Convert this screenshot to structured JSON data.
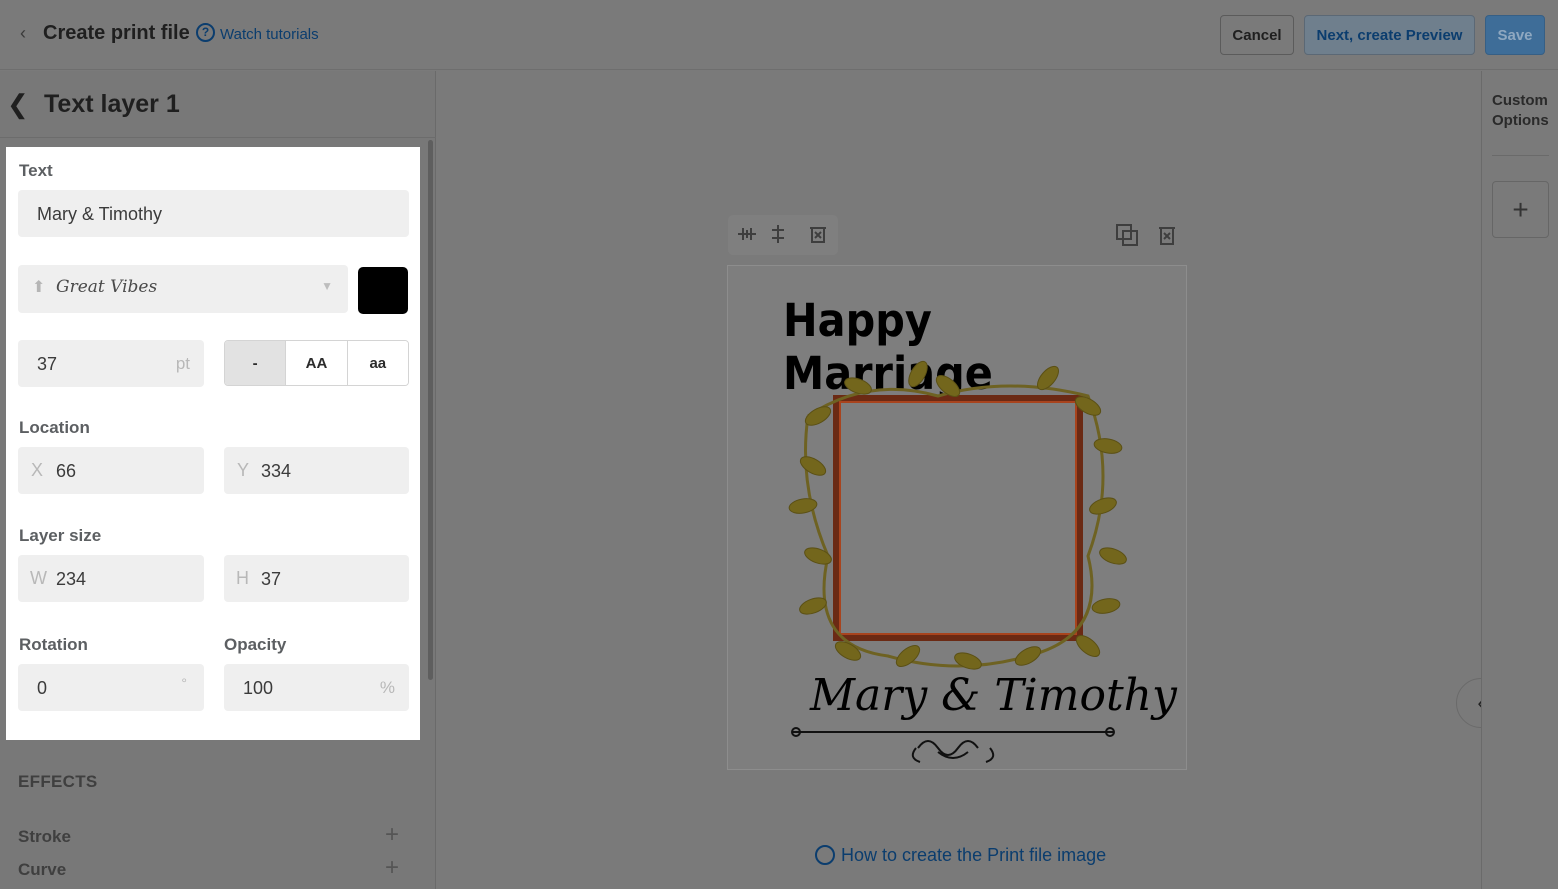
{
  "header": {
    "back_icon": "chevron-left-icon",
    "title": "Create print file",
    "help_icon": "question-circle-icon",
    "help_glyph": "?",
    "watch_tutorials": "Watch tutorials",
    "cancel": "Cancel",
    "next": "Next, create Preview",
    "save": "Save"
  },
  "layer_panel": {
    "back_icon": "chevron-left-icon",
    "title": "Text layer 1",
    "text_label": "Text",
    "text_value": "Mary & Timothy",
    "font_name": "Great Vibes",
    "font_color": "#000000",
    "size_value": "37",
    "size_unit": "pt",
    "case_options": [
      "-",
      "AA",
      "aa"
    ],
    "location_label": "Location",
    "x_prefix": "X",
    "x_value": "66",
    "y_prefix": "Y",
    "y_value": "334",
    "layer_size_label": "Layer size",
    "w_prefix": "W",
    "w_value": "234",
    "h_prefix": "H",
    "h_value": "37",
    "rotation_label": "Rotation",
    "rotation_value": "0",
    "rotation_unit": "°",
    "opacity_label": "Opacity",
    "opacity_value": "100",
    "opacity_unit": "%",
    "effects_label": "EFFECTS",
    "effects": [
      {
        "label": "Stroke",
        "icon": "plus-icon"
      },
      {
        "label": "Curve",
        "icon": "plus-icon"
      }
    ]
  },
  "canvas": {
    "headline": "Happy Marriage",
    "names": "Mary & Timothy",
    "help_link": "How to create the Print file image",
    "help_icon": "lifebuoy-icon"
  },
  "right_rail": {
    "custom_options": "Custom Options",
    "add_icon": "plus-icon",
    "collapse_icon": "chevron-left-icon"
  },
  "colors": {
    "overlay": "#7a7a7a",
    "link": "#0b3d6e",
    "primary": "#3e6d98"
  }
}
